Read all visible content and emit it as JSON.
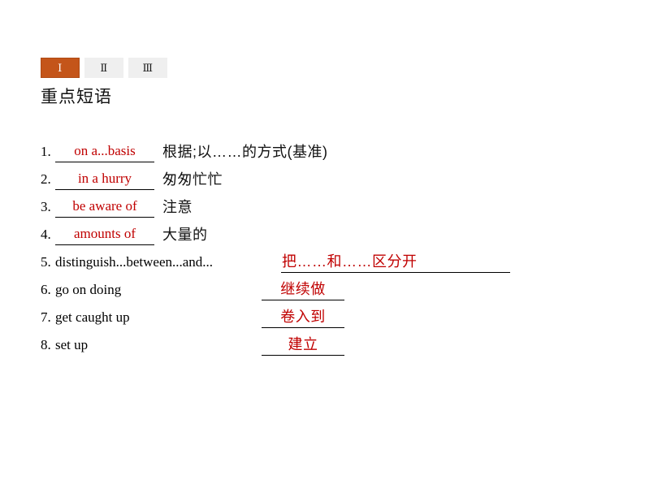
{
  "tabs": [
    {
      "label": "Ⅰ",
      "name": "tab-1",
      "active": true
    },
    {
      "label": "Ⅱ",
      "name": "tab-2",
      "active": false
    },
    {
      "label": "Ⅲ",
      "name": "tab-3",
      "active": false
    }
  ],
  "heading": "重点短语",
  "colors": {
    "tab_active_bg": "#c4551a",
    "tab_active_text": "#ffffff",
    "tab_inactive_bg": "#efefef",
    "answer_red": "#c00000",
    "page_bg": "#ffffff",
    "body_text": "#000000"
  },
  "items": [
    {
      "number": "1.",
      "answer": "on a...basis",
      "answer_lang": "en",
      "meaning": "根据;以……的方式(基准)",
      "layout": "blank-left"
    },
    {
      "number": "2.",
      "answer": "in a hurry",
      "answer_lang": "en",
      "meaning": "匆匆忙忙",
      "layout": "blank-left"
    },
    {
      "number": "3.",
      "answer": "be aware of",
      "answer_lang": "en",
      "meaning": "注意",
      "layout": "blank-left"
    },
    {
      "number": "4.",
      "answer": "amounts of",
      "answer_lang": "en",
      "meaning": "大量的",
      "layout": "blank-left"
    },
    {
      "number": "5.",
      "phrase": "distinguish...between...and...",
      "answer": "把……和……区分开",
      "answer_lang": "cn",
      "layout": "phrase-then-wide-blank"
    },
    {
      "number": "6.",
      "phrase": "go on doing",
      "answer": "继续做",
      "answer_lang": "cn",
      "layout": "phrase-then-blank"
    },
    {
      "number": "7.",
      "phrase": "get caught up",
      "answer": "卷入到",
      "answer_lang": "cn",
      "layout": "phrase-then-blank"
    },
    {
      "number": "8.",
      "phrase": "set up",
      "answer": "建立",
      "answer_lang": "cn",
      "layout": "phrase-then-blank"
    }
  ]
}
